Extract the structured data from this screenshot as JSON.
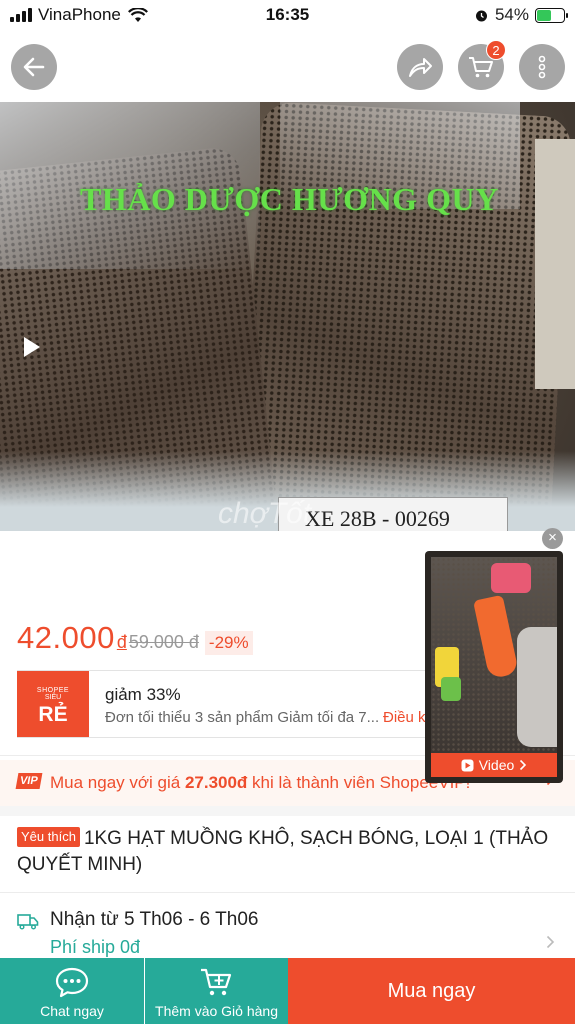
{
  "status_bar": {
    "carrier": "VinaPhone",
    "time": "16:35",
    "battery": "54%",
    "battery_level": 0.54
  },
  "nav": {
    "back_icon": "back-arrow-icon",
    "share_icon": "share-icon",
    "cart_icon": "cart-icon",
    "cart_count": "2",
    "more_icon": "more-vertical-icon"
  },
  "product_image": {
    "overlay_text": "THẢO DƯỢC HƯƠNG QUY",
    "plate_text": "XE 28B - 00269",
    "watermark": "chợTốt"
  },
  "mini_video": {
    "label": "Video",
    "close": "×"
  },
  "price": {
    "current": "42.000",
    "currency": "đ",
    "original": "59.000 đ",
    "discount": "-29%"
  },
  "voucher": {
    "logo_line1": "SHOPEE",
    "logo_line2": "SIÊU",
    "logo_line3": "RẺ",
    "title": "giảm 33%",
    "description": "Đơn tối thiểu 3 sản phẩm Giảm tối đa 7...",
    "link": "Điều k"
  },
  "vip": {
    "badge": "VIP",
    "text_before": "Mua ngay với giá ",
    "price": "27.300đ",
    "text_after": " khi là thành viên ShopeeVIP!"
  },
  "product": {
    "badge": "Yêu thích",
    "title": "1KG HẠT MUỒNG KHÔ, SẠCH BÓNG, LOẠI 1 (THẢO QUYẾT MINH)"
  },
  "shipping": {
    "delivery": "Nhận từ 5 Th06 - 6 Th06",
    "fee": "Phí ship 0đ"
  },
  "bottom_bar": {
    "chat": "Chat ngay",
    "add_to_cart": "Thêm vào Giỏ hàng",
    "buy_now": "Mua ngay"
  },
  "colors": {
    "accent": "#ee4d2d",
    "teal": "#26aa99"
  }
}
